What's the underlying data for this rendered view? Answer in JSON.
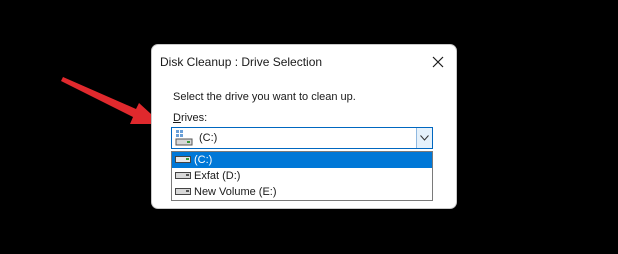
{
  "dialog": {
    "title": "Disk Cleanup : Drive Selection",
    "close_icon": "close-icon",
    "instruction": "Select the drive you want to clean up.",
    "drives_label_accel": "D",
    "drives_label_rest": "rives:"
  },
  "combo": {
    "selected": "(C:)",
    "icon": "windows-drive-icon",
    "dropdown_icon": "chevron-down-icon"
  },
  "list": {
    "items": [
      {
        "label": "(C:)",
        "icon": "drive-icon",
        "selected": true
      },
      {
        "label": "Exfat (D:)",
        "icon": "drive-icon",
        "selected": false
      },
      {
        "label": "New Volume (E:)",
        "icon": "drive-icon",
        "selected": false
      }
    ]
  },
  "annotation": {
    "icon": "red-arrow-icon",
    "color": "#e0292d"
  },
  "colors": {
    "accent": "#0078d7",
    "background": "#000000"
  }
}
